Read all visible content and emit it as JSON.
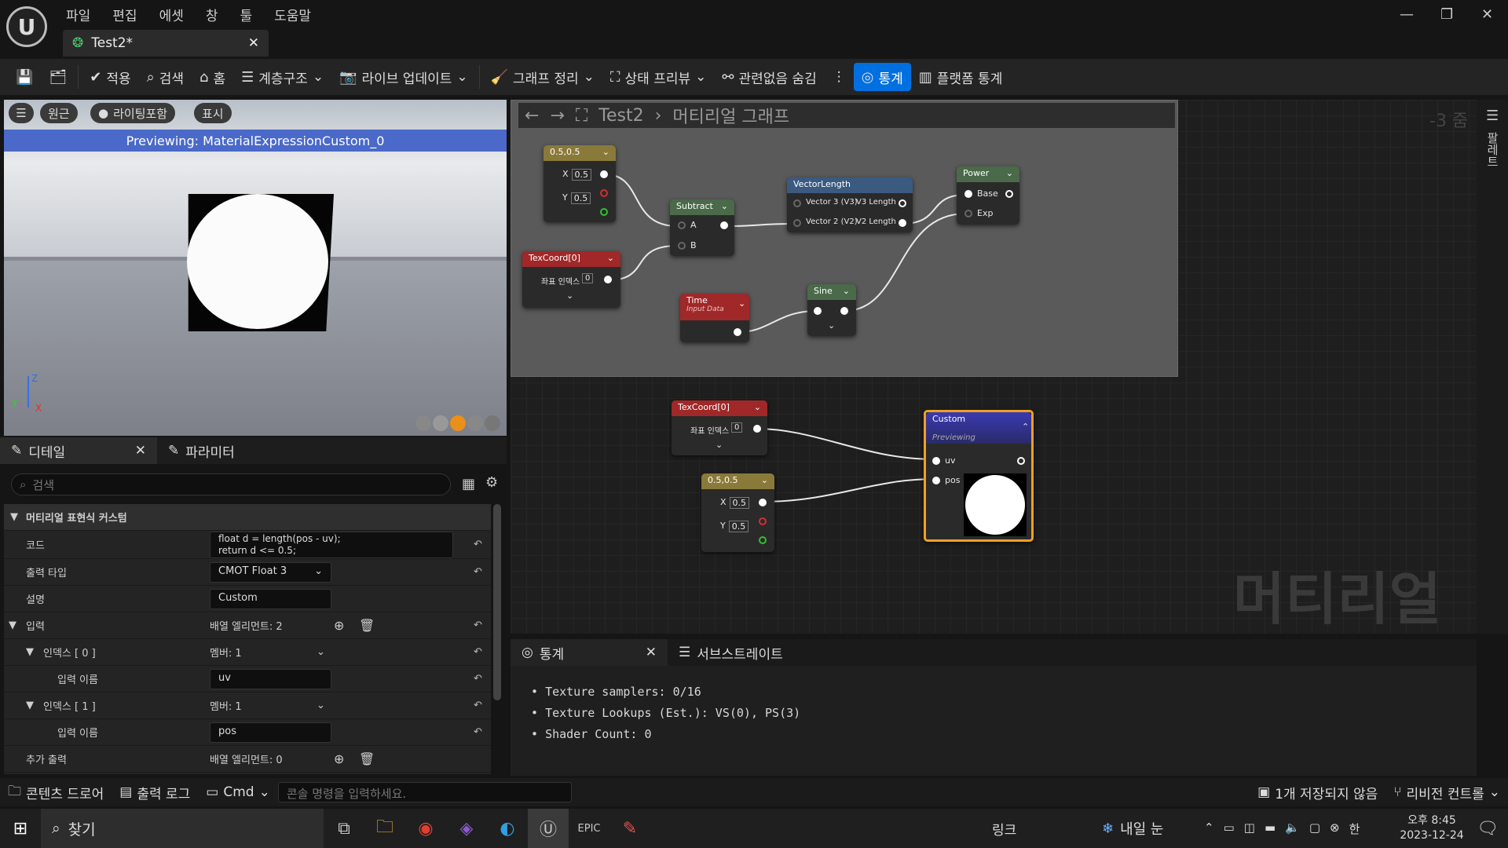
{
  "menu": [
    "파일",
    "편집",
    "에셋",
    "창",
    "툴",
    "도움말"
  ],
  "tab": {
    "title": "Test2*"
  },
  "toolbar": {
    "save": "",
    "browse": "",
    "apply": "적용",
    "search": "검색",
    "home": "홈",
    "hierarchy": "계층구조",
    "live_update": "라이브 업데이트",
    "clean_graph": "그래프 정리",
    "preview_state": "상태 프리뷰",
    "hide_unrelated": "관련없음 숨김",
    "stats": "통계",
    "platform_stats": "플랫폼 통계"
  },
  "viewport": {
    "perspective": "원근",
    "lighting": "라이팅포함",
    "show": "표시",
    "previewing": "Previewing: MaterialExpressionCustom_0",
    "axis_z": "Z",
    "axis_x": "X",
    "axis_y": "Y"
  },
  "details": {
    "tab_details": "디테일",
    "tab_params": "파라미터",
    "search_placeholder": "검색",
    "category": "머티리얼 표현식 커스텀",
    "code_label": "코드",
    "code_value1": "float d = length(pos - uv);",
    "code_value2": "return d <= 0.5;",
    "output_type_label": "출력 타입",
    "output_type_value": "CMOT Float 3",
    "desc_label": "설명",
    "desc_value": "Custom",
    "inputs_label": "입력",
    "inputs_count": "배열 엘리먼트: 2",
    "idx0_label": "인덱스 [ 0 ]",
    "idx0_members": "멤버: 1",
    "input_name_label": "입력 이름",
    "idx0_name": "uv",
    "idx1_label": "인덱스 [ 1 ]",
    "idx1_members": "멤버: 1",
    "idx1_name": "pos",
    "extra_out_label": "추가 출력",
    "extra_out_count": "배열 엘리먼트: 0"
  },
  "graph": {
    "breadcrumb_root": "Test2",
    "breadcrumb_leaf": "머티리얼 그래프",
    "zoom": "-3 줌",
    "watermark": "머티리얼",
    "palette": "팔레트",
    "n_const": "0.5,0.5",
    "n_sub": "Subtract",
    "n_vlen": "VectorLength",
    "n_pow": "Power",
    "n_tex": "TexCoord[0]",
    "n_time": "Time",
    "n_time_sub": "Input Data",
    "n_sine": "Sine",
    "n_custom": "Custom",
    "n_custom_sub": "Previewing",
    "pin_x": "X",
    "pin_y": "Y",
    "val05": "0.5",
    "pin_a": "A",
    "pin_b": "B",
    "pin_v3": "Vector 3 (V3)",
    "pin_v3l": "V3 Length",
    "pin_v2": "Vector 2 (V2)",
    "pin_v2l": "V2 Length",
    "pin_base": "Base",
    "pin_exp": "Exp",
    "pin_coord": "좌표 인덱스",
    "coord_val": "0",
    "pin_uv": "uv",
    "pin_pos": "pos"
  },
  "stats": {
    "tab_stats": "통계",
    "tab_substrate": "서브스트레이트",
    "line1": "Texture samplers: 0/16",
    "line2": "Texture Lookups (Est.): VS(0), PS(3)",
    "line3": "Shader Count: 0"
  },
  "bottom": {
    "content_drawer": "콘텐츠 드로어",
    "output_log": "출력 로그",
    "cmd": "Cmd",
    "console_placeholder": "콘솔 명령을 입력하세요.",
    "unsaved": "1개 저장되지 않음",
    "revision": "리비전 컨트롤"
  },
  "taskbar": {
    "search": "찾기",
    "link": "링크",
    "weather": "내일 눈",
    "time": "오후 8:45",
    "date": "2023-12-24",
    "ime": "한"
  }
}
